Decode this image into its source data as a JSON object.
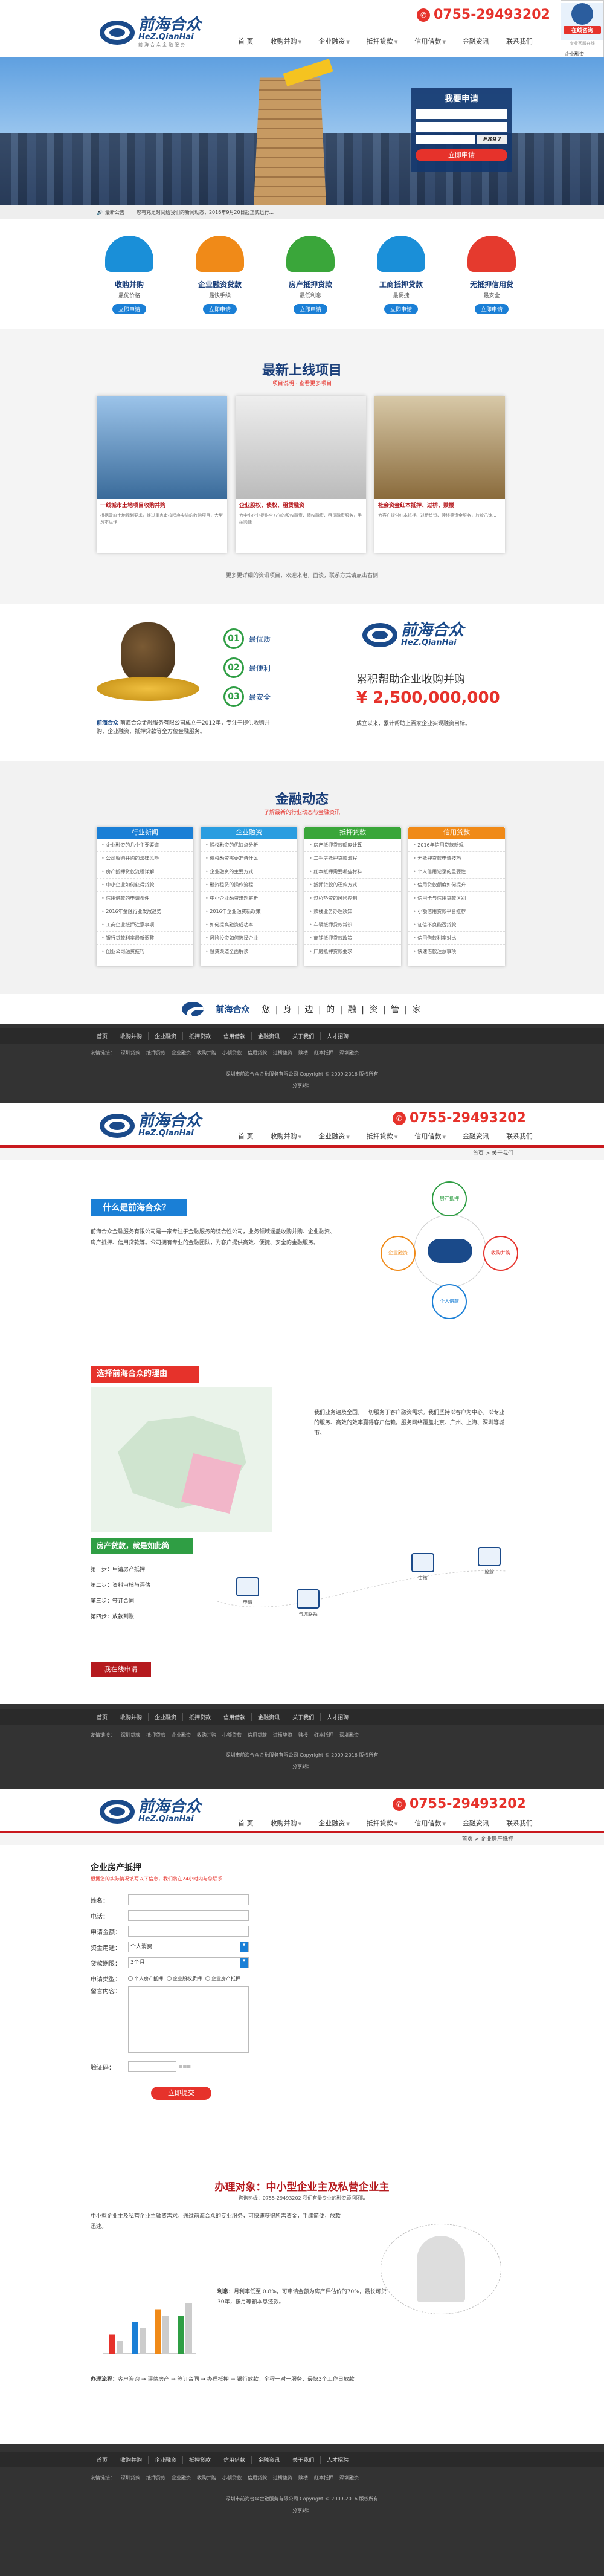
{
  "header": {
    "logo_cn": "前海合众",
    "logo_en": "HeZ.QianHai",
    "logo_sub": "前海合众金融服务",
    "phone": "0755-29493202",
    "nav": [
      "首 页",
      "收购并购",
      "企业融资",
      "抵押贷款",
      "信用借款",
      "金融资讯",
      "联系我们"
    ]
  },
  "service": {
    "title": "在线咨询",
    "sub": "专业客服在线",
    "items": [
      "企业融资",
      "收购并购",
      "抵押贷款",
      "信用借款",
      "收购并购",
      "贷款加盟"
    ],
    "tel": "0755-29493202"
  },
  "banner": {
    "apply_title": "我要申请",
    "captcha": "F897",
    "submit": "立即申请"
  },
  "notice": {
    "label": "最新公告",
    "text": "您有充足时间给我们的新闻动态，2016年9月20日起正式运行..."
  },
  "products": [
    {
      "title": "收购并购",
      "sub": "最优价格",
      "btn": "立即申请",
      "color": "#1a8fd8"
    },
    {
      "title": "企业融资贷款",
      "sub": "最快手续",
      "btn": "立即申请",
      "color": "#f08a18"
    },
    {
      "title": "房产抵押贷款",
      "sub": "最低利息",
      "btn": "立即申请",
      "color": "#3aa63a"
    },
    {
      "title": "工商抵押贷款",
      "sub": "最便捷",
      "btn": "立即申请",
      "color": "#1a8fd8"
    },
    {
      "title": "无抵押信用贷",
      "sub": "最安全",
      "btn": "立即申请",
      "color": "#e53a2e"
    }
  ],
  "projects": {
    "title": "最新上线项目",
    "sub": "项目说明 · 查看更多项目",
    "items": [
      {
        "title": "一线城市土地项目收购并购",
        "desc": "根据政府土地规划要求，经过重点审核程序实施的收购项目，大型资本运作..."
      },
      {
        "title": "企业股权、债权、租赁融资",
        "desc": "为中小企业提供全方位的股权融资、债权融资、租赁融资服务，手续简便..."
      },
      {
        "title": "社会资金红本抵押、过桥、赎楼",
        "desc": "为客户提供红本抵押、过桥垫资、赎楼等资金服务，放款迅速..."
      }
    ],
    "more": "更多更详细的资讯项目，欢迎来电，面谈，联系方式请点击右侧"
  },
  "about": {
    "points": [
      "最优质",
      "最便利",
      "最安全"
    ],
    "desc_name": "前海合众",
    "desc": "前海合众金融服务有限公司成立于2012年，专注于提供收购并购、企业融资、抵押贷款等全方位金融服务。",
    "headline": "累积帮助企业收购并购",
    "amount": "¥ 2,500,000,000",
    "desc2": "成立以来，累计帮助上百家企业实现融资目标。"
  },
  "finance": {
    "title": "金融动态",
    "sub": "了解最新的行业动态与金融资讯",
    "cols": [
      {
        "head": "行业新闻",
        "color": "#1a7fd6",
        "items": [
          "企业融资的几个主要渠道",
          "公司收购并购的法律风险",
          "房产抵押贷款流程详解",
          "中小企业如何获得贷款",
          "信用借款的申请条件",
          "2016年金融行业发展趋势",
          "工商企业抵押注意事项",
          "银行贷款利率最新调整",
          "创业公司融资技巧"
        ]
      },
      {
        "head": "企业融资",
        "color": "#2a9de0",
        "items": [
          "股权融资的优缺点分析",
          "债权融资需要准备什么",
          "企业融资的主要方式",
          "融资租赁的操作流程",
          "中小企业融资难题解析",
          "2016年企业融资新政策",
          "如何提高融资成功率",
          "风险投资如何选择企业",
          "融资渠道全面解读"
        ]
      },
      {
        "head": "抵押贷款",
        "color": "#3aa63a",
        "items": [
          "房产抵押贷款额度计算",
          "二手房抵押贷款流程",
          "红本抵押需要哪些材料",
          "抵押贷款的还款方式",
          "过桥垫资的风险控制",
          "赎楼业务办理须知",
          "车辆抵押贷款常识",
          "商铺抵押贷款政策",
          "厂房抵押贷款要求"
        ]
      },
      {
        "head": "信用贷款",
        "color": "#f08a18",
        "items": [
          "2016年信用贷款新规",
          "无抵押贷款申请技巧",
          "个人信用记录的重要性",
          "信用贷款额度如何提升",
          "信用卡与信用贷款区别",
          "小额信用贷款平台推荐",
          "征信不良能否贷款",
          "信用借款利率对比",
          "快速借款注意事项"
        ]
      }
    ]
  },
  "partners": {
    "text": "您 | 身 | 边 | 的 | 融 | 资 | 管 | 家"
  },
  "footer": {
    "nav": [
      "首页",
      "收购并购",
      "企业融资",
      "抵押贷款",
      "信用借款",
      "金融资讯",
      "关于我们",
      "人才招聘"
    ],
    "links": [
      "友情链接：",
      "深圳贷款",
      "抵押贷款",
      "企业融资",
      "收购并购",
      "小额贷款",
      "信用贷款",
      "过桥垫资",
      "赎楼",
      "红本抵押",
      "深圳融资"
    ],
    "copyright": "深圳市前海合众金融服务有限公司  Copyright © 2009-2016 版权所有",
    "share": "分享到："
  },
  "page2": {
    "breadcrumb": "首页 > 关于我们",
    "what_title": "什么是前海合众？",
    "what_desc": "前海合众金融服务有限公司是一家专注于金融服务的综合性公司，业务领域涵盖收购并购、企业融资、房产抵押、信用贷款等。公司拥有专业的金融团队，为客户提供高效、便捷、安全的金融服务。",
    "circles": [
      "房产抵押",
      "企业融资",
      "个人借款",
      "收购并购"
    ],
    "why_title": "选择前海合众的理由",
    "why_desc": "我们业务遍及全国，一切服务于客户融资需求。我们坚持以客户为中心，以专业的服务、高效的效率赢得客户信赖。服务网络覆盖北京、广州、上海、深圳等城市。",
    "loan_title": "房产贷款，就是如此简",
    "steps": [
      "第一步：申请房产抵押",
      "第二步：资料审核与评估",
      "第三步：签订合同",
      "第四步：放款到账"
    ],
    "step_icons": [
      "申请",
      "与您联系",
      "审核",
      "放款"
    ],
    "apply_btn": "我在线申请"
  },
  "page3": {
    "breadcrumb": "首页 > 企业房产抵押",
    "form_title": "企业房产抵押",
    "form_sub": "根据您的实际情况填写以下信息，我们将在24小时内与您联系",
    "fields": [
      "姓名：",
      "电话：",
      "申请金额：",
      "资金用途：",
      "贷款期限：",
      "申请类型：",
      "留言内容：",
      "验证码："
    ],
    "select1": "个人消费",
    "select2": "3个月",
    "types": [
      "个人房产抵押",
      "企业股权质押",
      "企业房产抵押"
    ],
    "submit": "立即提交",
    "target_title": "办理对象：中小型企业主及私营企业主",
    "target_sub": "咨询热线：0755-29493202  我们有最专业的融资顾问团队",
    "desc1": "中小型企业主及私营企业主融资需求，通过前海合众的专业服务，可快速获得所需资金，手续简便，放款迅速。",
    "rate_label": "利息：",
    "rate": "月利率低至 0.8%，可申请金额为房产评估价的70%，最长可贷30年，按月等额本息还款。",
    "chart_data": {
      "type": "bar",
      "categories": [
        "A",
        "B",
        "C",
        "D"
      ],
      "series": [
        {
          "name": "",
          "values": [
            3,
            5,
            7,
            6
          ]
        },
        {
          "name": "",
          "values": [
            2,
            4,
            6,
            8
          ]
        }
      ],
      "title": "",
      "xlabel": "",
      "ylabel": "",
      "ylim": [
        0,
        10
      ]
    },
    "process_label": "办理流程：",
    "process": "客户咨询 → 评估房产 → 签订合同 → 办理抵押 → 银行放款，全程一对一服务，最快3个工作日放款。"
  }
}
